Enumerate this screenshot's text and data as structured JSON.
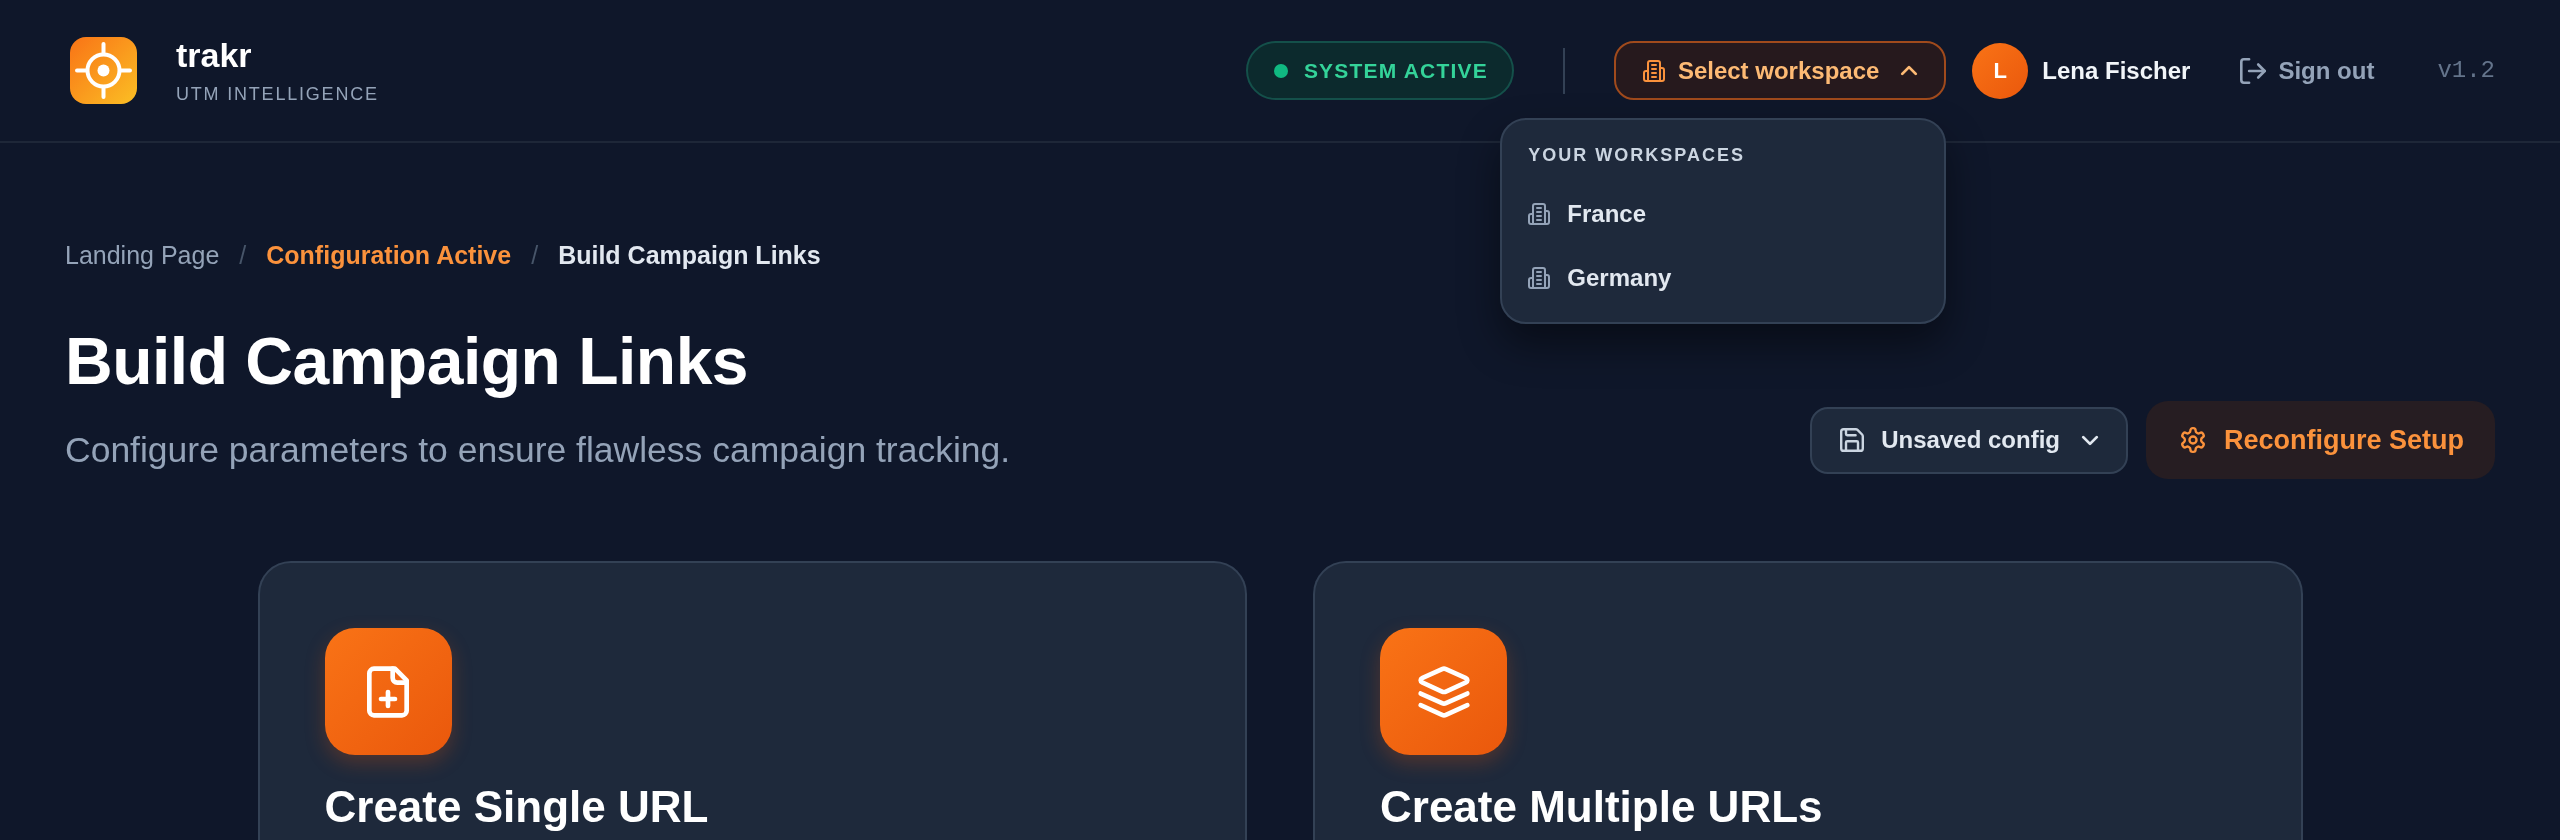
{
  "header": {
    "brand": {
      "name": "trakr",
      "tagline": "UTM INTELLIGENCE"
    },
    "status": {
      "label": "SYSTEM ACTIVE",
      "active": true
    },
    "workspace_button": {
      "label": "Select workspace",
      "expanded": true
    },
    "user": {
      "initial": "L",
      "name": "Lena Fischer"
    },
    "sign_out": {
      "label": "Sign out"
    },
    "version": "v1.2"
  },
  "workspace_menu": {
    "heading": "YOUR WORKSPACES",
    "items": [
      {
        "label": "France",
        "selected": false
      },
      {
        "label": "Germany",
        "selected": false
      }
    ]
  },
  "breadcrumb": [
    {
      "label": "Landing Page",
      "kind": "link"
    },
    {
      "label": "/",
      "kind": "separator"
    },
    {
      "label": "Configuration Active",
      "kind": "highlight"
    },
    {
      "label": "/",
      "kind": "separator"
    },
    {
      "label": "Build Campaign Links",
      "kind": "current"
    }
  ],
  "page": {
    "title": "Build Campaign Links",
    "subtitle": "Configure parameters to ensure flawless campaign tracking."
  },
  "actions": {
    "config_select": {
      "label": "Unsaved config"
    },
    "reconfigure": {
      "label": "Reconfigure Setup"
    }
  },
  "cards": [
    {
      "title": "Create Single URL",
      "kind": "single"
    },
    {
      "title": "Create Multiple URLs",
      "kind": "multiple"
    }
  ]
}
